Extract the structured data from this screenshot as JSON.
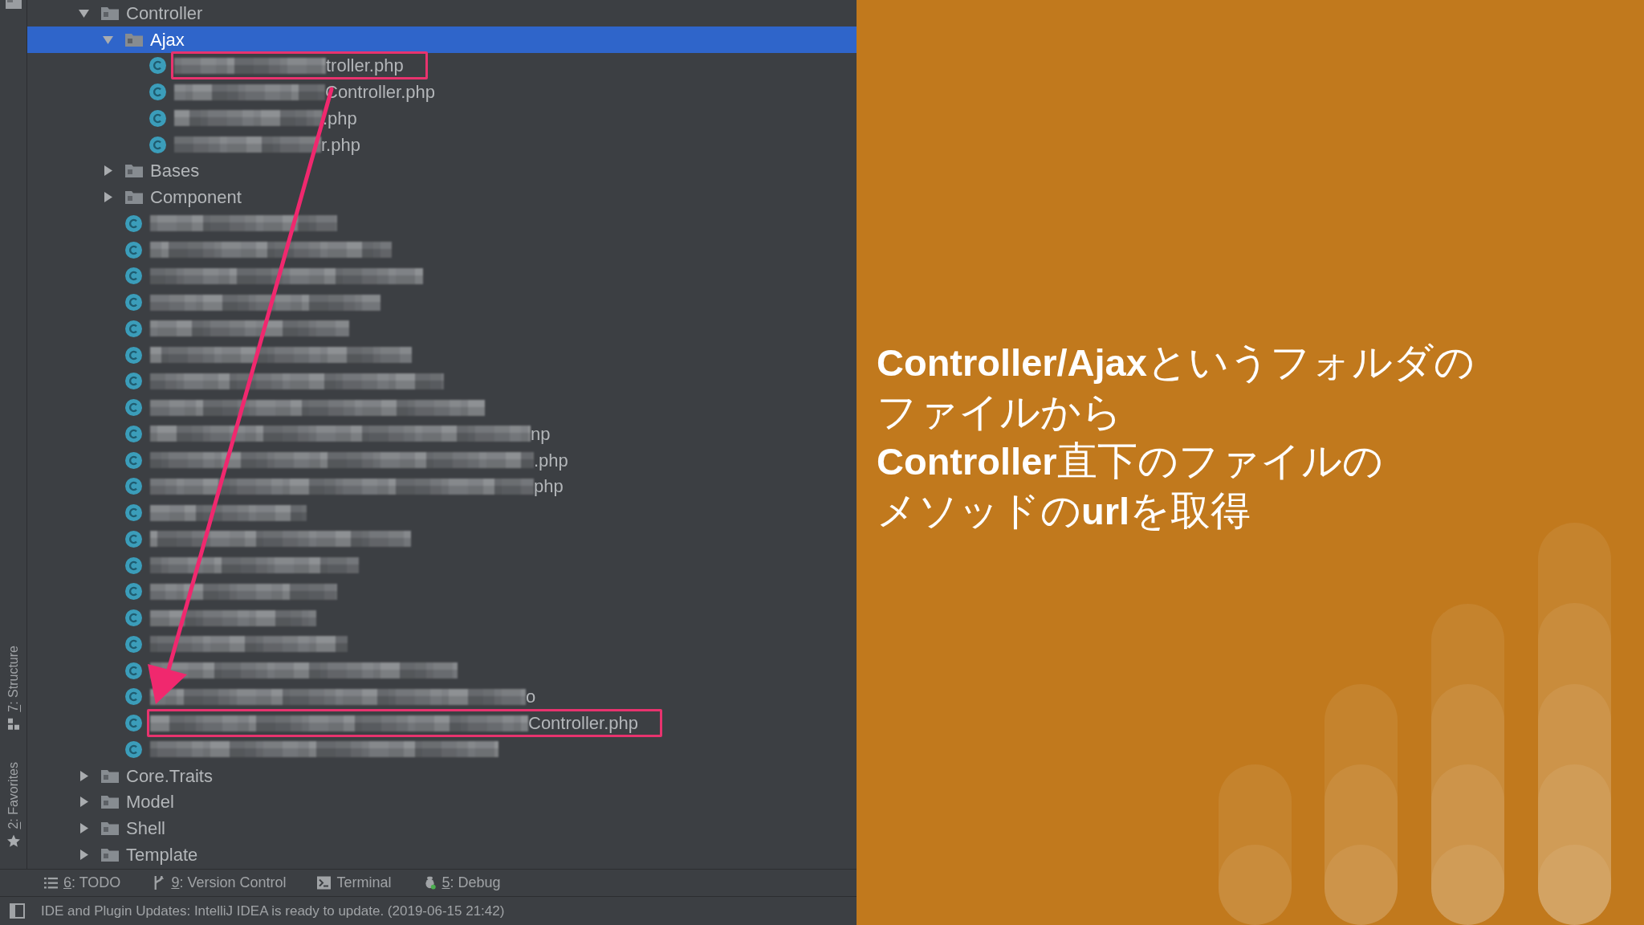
{
  "tool_strip": {
    "tabs": [
      {
        "kind": "structure",
        "key": "7",
        "label": ": Structure"
      },
      {
        "kind": "favorites",
        "key": "2",
        "label": ": Favorites"
      }
    ]
  },
  "project_tree": {
    "items": [
      {
        "kind": "folder",
        "name": "Controller",
        "expanded": true,
        "selected": false,
        "children": [
          {
            "kind": "folder",
            "name": "Ajax",
            "expanded": true,
            "selected": true,
            "children": [
              {
                "kind": "file",
                "name": "troller.php",
                "redacted": true,
                "highlighted": true,
                "selected": false
              },
              {
                "kind": "file",
                "name": "Controller.php",
                "redacted": true,
                "highlighted": false,
                "selected": false
              },
              {
                "kind": "file",
                "name": ".php",
                "redacted": true,
                "highlighted": false,
                "selected": false
              },
              {
                "kind": "file",
                "name": "r.php",
                "redacted": true,
                "highlighted": false,
                "selected": false
              }
            ]
          },
          {
            "kind": "folder",
            "name": "Bases",
            "expanded": false,
            "selected": false
          },
          {
            "kind": "folder",
            "name": "Component",
            "expanded": false,
            "selected": false
          },
          {
            "kind": "file",
            "redacted": true,
            "highlighted": false,
            "selected": false
          },
          {
            "kind": "file",
            "redacted": true,
            "highlighted": false,
            "selected": false
          },
          {
            "kind": "file",
            "redacted": true,
            "highlighted": false,
            "selected": false
          },
          {
            "kind": "file",
            "redacted": true,
            "highlighted": false,
            "selected": false
          },
          {
            "kind": "file",
            "redacted": true,
            "highlighted": false,
            "selected": false
          },
          {
            "kind": "file",
            "redacted": true,
            "highlighted": false,
            "selected": false
          },
          {
            "kind": "file",
            "redacted": true,
            "highlighted": false,
            "selected": false
          },
          {
            "kind": "file",
            "redacted": true,
            "highlighted": false,
            "selected": false
          },
          {
            "kind": "file",
            "name": "np",
            "redacted": true,
            "highlighted": false,
            "selected": false
          },
          {
            "kind": "file",
            "name": ".php",
            "redacted": true,
            "highlighted": false,
            "selected": false
          },
          {
            "kind": "file",
            "name": "php",
            "redacted": true,
            "highlighted": false,
            "selected": false
          },
          {
            "kind": "file",
            "redacted": true,
            "highlighted": false,
            "selected": false
          },
          {
            "kind": "file",
            "redacted": true,
            "highlighted": false,
            "selected": false
          },
          {
            "kind": "file",
            "redacted": true,
            "highlighted": false,
            "selected": false
          },
          {
            "kind": "file",
            "redacted": true,
            "highlighted": false,
            "selected": false
          },
          {
            "kind": "file",
            "redacted": true,
            "highlighted": false,
            "selected": false
          },
          {
            "kind": "file",
            "redacted": true,
            "highlighted": false,
            "selected": false
          },
          {
            "kind": "file",
            "redacted": true,
            "highlighted": false,
            "selected": false
          },
          {
            "kind": "file",
            "name": "o",
            "redacted": true,
            "highlighted": false,
            "selected": false
          },
          {
            "kind": "file",
            "name": "Controller.php",
            "redacted": true,
            "highlighted": true,
            "selected": false
          },
          {
            "kind": "file",
            "redacted": true,
            "highlighted": false,
            "selected": false
          }
        ]
      },
      {
        "kind": "folder",
        "name": "Core.Traits",
        "expanded": false,
        "selected": false
      },
      {
        "kind": "folder",
        "name": "Model",
        "expanded": false,
        "selected": false
      },
      {
        "kind": "folder",
        "name": "Shell",
        "expanded": false,
        "selected": false
      },
      {
        "kind": "folder",
        "name": "Template",
        "expanded": false,
        "selected": false
      }
    ]
  },
  "tool_window_bar": {
    "buttons": [
      {
        "kind": "todo",
        "key": "6",
        "label": ": TODO"
      },
      {
        "kind": "vcs",
        "key": "9",
        "label": ": Version Control"
      },
      {
        "kind": "terminal",
        "label": "Terminal"
      },
      {
        "kind": "debug",
        "key": "5",
        "label": ": Debug"
      }
    ]
  },
  "status_bar": {
    "message": "IDE and Plugin Updates: IntelliJ IDEA is ready to update. (2019-06-15 21:42)"
  },
  "slide": {
    "caption": [
      "**Controller/Ajax**というフォルダの",
      "ファイルから",
      "**Controller**直下のファイルの",
      "メソッドの**url**を取得"
    ]
  }
}
